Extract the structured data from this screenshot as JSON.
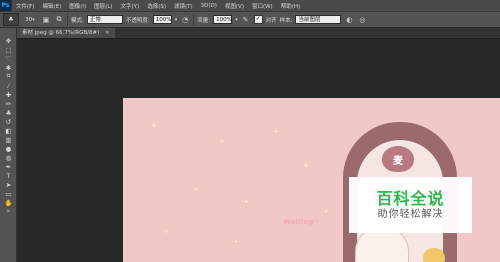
{
  "menubar": {
    "app_logo": "Ps",
    "items": [
      "文件(F)",
      "编辑(E)",
      "图像(I)",
      "图层(L)",
      "文字(Y)",
      "选择(S)",
      "滤镜(T)",
      "3D(D)",
      "视图(V)",
      "窗口(W)",
      "帮助(H)"
    ]
  },
  "options": {
    "brush_size": "30",
    "mode_label": "模式:",
    "mode_value": "正常",
    "opacity_label": "不透明度:",
    "opacity_value": "100%",
    "flow_label": "流量:",
    "flow_value": "100%",
    "aligned_label": "对齐",
    "sample_label": "样本:",
    "sample_value": "当前图层"
  },
  "document": {
    "tab_title": "素材.jpeg @ 66.7%(RGB/8#)",
    "close_glyph": "×"
  },
  "canvas": {
    "waiting_text": "Waiting···",
    "heart_glyph": "麦"
  },
  "watermark": {
    "title": "百科全说",
    "subtitle": "助你轻松解决",
    "title_color": "#2db84c"
  },
  "tools": [
    "move-tool",
    "marquee-tool",
    "lasso-tool",
    "quick-select-tool",
    "crop-tool",
    "eyedropper-tool",
    "healing-brush-tool",
    "brush-tool",
    "clone-stamp-tool",
    "history-brush-tool",
    "eraser-tool",
    "gradient-tool",
    "blur-tool",
    "dodge-tool",
    "pen-tool",
    "type-tool",
    "path-select-tool",
    "shape-tool",
    "hand-tool",
    "zoom-tool"
  ]
}
